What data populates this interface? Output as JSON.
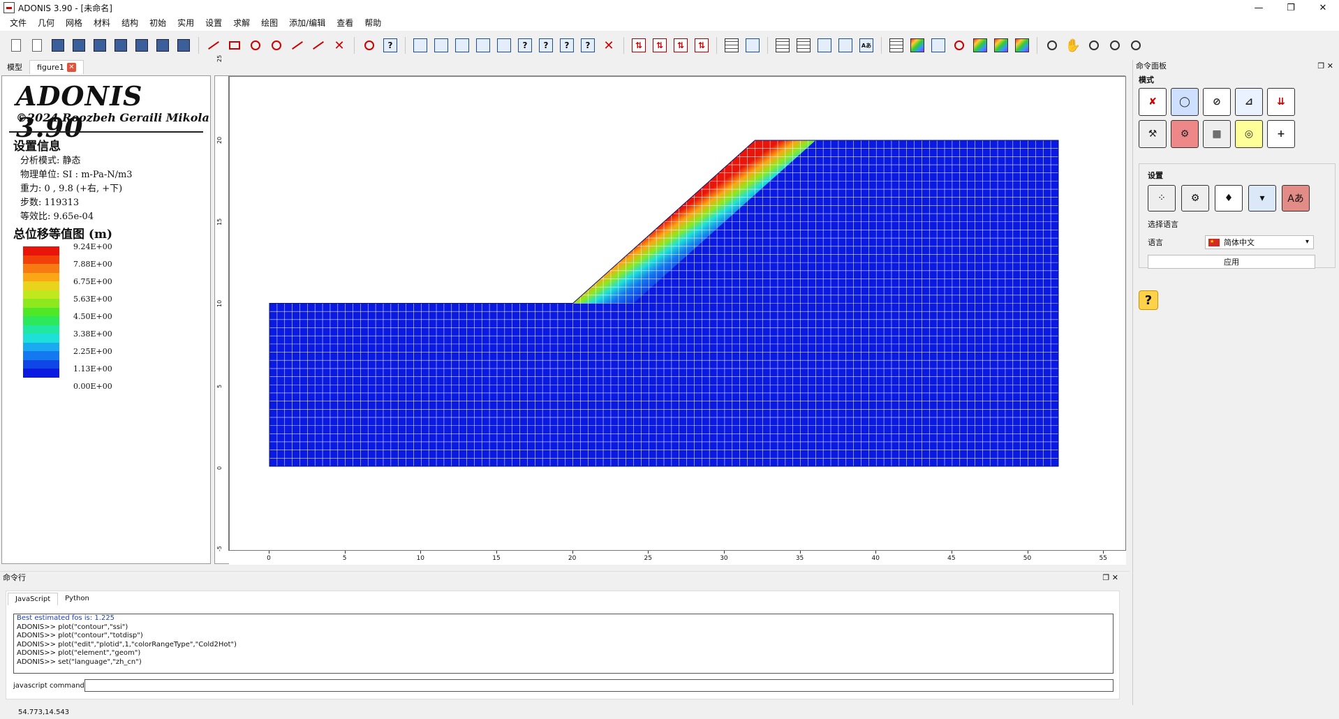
{
  "window": {
    "title": "ADONIS 3.90 - [未命名]",
    "minimize": "—",
    "maximize": "❐",
    "close": "✕"
  },
  "menu": [
    "文件",
    "几何",
    "网格",
    "材料",
    "结构",
    "初始",
    "实用",
    "设置",
    "求解",
    "绘图",
    "添加/编辑",
    "查看",
    "帮助"
  ],
  "tabs": {
    "model": "模型",
    "figure": "figure1",
    "close": "✕"
  },
  "info": {
    "brand": "ADONIS 3.90",
    "copyright": "©2024 Roozbeh Geraili Mikola",
    "section_title": "设置信息",
    "analysis_mode": "分析模式: 静态",
    "units": "物理单位: SI : m-Pa-N/m3",
    "gravity": "重力: 0 , 9.8 (+右, +下)",
    "steps": "步数: 119313",
    "ratio": "等效比: 9.65e-04",
    "plot_title": "总位移等值图 (m)"
  },
  "legend": {
    "labels": [
      "9.24E+00",
      "7.88E+00",
      "6.75E+00",
      "5.63E+00",
      "4.50E+00",
      "3.38E+00",
      "2.25E+00",
      "1.13E+00",
      "0.00E+00"
    ],
    "colors": [
      "#e8150b",
      "#f2400a",
      "#f77b12",
      "#fba614",
      "#e8d41a",
      "#bfe81e",
      "#8de81e",
      "#4fe826",
      "#2ee85c",
      "#20e8a0",
      "#1ee0d8",
      "#1aaaf0",
      "#1478f0",
      "#0f46e8",
      "#0a1ae0"
    ]
  },
  "chart_data": {
    "type": "mesh-contour",
    "x_ticks": [
      "0",
      "5",
      "10",
      "15",
      "20",
      "25",
      "30",
      "35",
      "40",
      "45",
      "50",
      "55"
    ],
    "y_ticks": [
      "25",
      "20",
      "15",
      "10",
      "5",
      "0",
      "-5"
    ],
    "geometry": [
      [
        0,
        0
      ],
      [
        52,
        0
      ],
      [
        52,
        20
      ],
      [
        32,
        20
      ],
      [
        20,
        10
      ],
      [
        0,
        10
      ]
    ],
    "xlim": [
      -3,
      55
    ],
    "ylim": [
      -5.5,
      25
    ]
  },
  "command_panel": {
    "title": "命令面板",
    "mode_label": "模式",
    "settings_label": "设置",
    "language_section": "选择语言",
    "language_label": "语言",
    "language_value": "简体中文",
    "apply": "应用",
    "help": "?",
    "mode_buttons": [
      "✘",
      "◯",
      "⊘",
      "⊿",
      "⇊",
      "⚒",
      "⚙",
      "▦",
      "◎",
      "+"
    ],
    "setting_buttons": [
      "⁘",
      "⚙",
      "♦",
      "▾",
      "Aあ"
    ]
  },
  "command_line": {
    "title": "命令行",
    "tab_js": "JavaScript",
    "tab_py": "Python",
    "log": [
      "Best estimated fos is: 1.225",
      "ADONIS>> plot(\"contour\",\"ssi\")",
      "ADONIS>> plot(\"contour\",\"totdisp\")",
      "ADONIS>> plot(\"edit\",\"plotid\",1,\"colorRangeType\",\"Cold2Hot\")",
      "ADONIS>> plot(\"element\",\"geom\")",
      "ADONIS>> set(\"language\",\"zh_cn\")"
    ],
    "input_label": "javascript command",
    "input_value": ""
  },
  "status": {
    "coords": "54.773,14.543"
  },
  "toolbar_icons": [
    "new-icon",
    "open-icon",
    "save-icon",
    "dxf-icon",
    "import-icon",
    "box-icon",
    "export-icon",
    "print-icon",
    "printer-icon",
    "line-icon",
    "rect-icon",
    "circle-icon",
    "arc-icon",
    "measure-icon",
    "distance-icon",
    "delete-icon",
    "boundary-icon",
    "help-q-icon",
    "surface-icon",
    "fix-x-icon",
    "fix-y-icon",
    "fix-xy-icon",
    "load-icon",
    "query1-icon",
    "query2-icon",
    "query3-icon",
    "query4-icon",
    "clear-icon",
    "support1-icon",
    "support2-icon",
    "support3-icon",
    "support4-icon",
    "table-icon",
    "chart-icon",
    "elem-icon",
    "node-icon",
    "material-icon",
    "layer-icon",
    "text-icon",
    "calc-icon",
    "contour-icon",
    "vector-icon",
    "ring-icon",
    "flow-icon",
    "graph-icon",
    "palette-icon",
    "zoom-fit-icon",
    "hand-icon",
    "zoom-icon",
    "zoom-in-icon",
    "zoom-out-icon"
  ]
}
